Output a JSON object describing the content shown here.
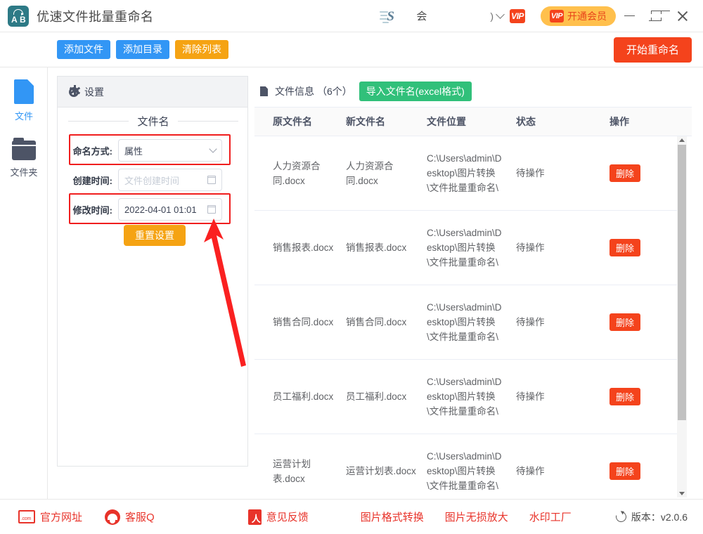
{
  "titlebar": {
    "app_name": "优速文件批量重命名",
    "app_icon": "rename-app-icon",
    "account_name": "会",
    "account_paren": ")",
    "vip_square_label": "VIP",
    "vip_button_label": "开通会员",
    "vip_button_color": "#ffc04d",
    "vip_button_text_color": "#e8451a",
    "minimize_label": "minimize",
    "maximize_label": "maximize",
    "close_label": "close"
  },
  "toolbar": {
    "add_file": "添加文件",
    "add_dir": "添加目录",
    "clear_list": "清除列表",
    "start_rename": "开始重命名",
    "blue": "#3296f5",
    "orange": "#f5a313",
    "red": "#f4431c"
  },
  "rail": {
    "items": [
      {
        "label": "文件",
        "icon": "document-icon",
        "active": true
      },
      {
        "label": "文件夹",
        "icon": "folder-icon",
        "active": false
      }
    ]
  },
  "settings": {
    "header_title": "设置",
    "header_icon": "gear-icon",
    "section_title": "文件名",
    "reset_label": "重置设置",
    "rows": [
      {
        "label": "命名方式:",
        "value": "属性",
        "placeholder": "",
        "kind": "select",
        "highlighted": true
      },
      {
        "label": "创建时间:",
        "value": "",
        "placeholder": "文件创建时间",
        "kind": "date",
        "highlighted": false
      },
      {
        "label": "修改时间:",
        "value": "2022-04-01 01:01",
        "placeholder": "",
        "kind": "date",
        "highlighted": true
      }
    ],
    "highlight_color": "#f01e1e"
  },
  "filelist": {
    "title": "文件信息",
    "count": "（6个）",
    "import_label": "导入文件名(excel格式)",
    "import_color": "#31c07a",
    "columns": [
      "原文件名",
      "新文件名",
      "文件位置",
      "状态",
      "操作"
    ],
    "delete_label": "删除",
    "rows": [
      {
        "original": "人力资源合同.docx",
        "new": "人力资源合同.docx",
        "location": "C:\\Users\\admin\\Desktop\\图片转换\\文件批量重命名\\",
        "status": "待操作"
      },
      {
        "original": "销售报表.docx",
        "new": "销售报表.docx",
        "location": "C:\\Users\\admin\\Desktop\\图片转换\\文件批量重命名\\",
        "status": "待操作"
      },
      {
        "original": "销售合同.docx",
        "new": "销售合同.docx",
        "location": "C:\\Users\\admin\\Desktop\\图片转换\\文件批量重命名\\",
        "status": "待操作"
      },
      {
        "original": "员工福利.docx",
        "new": "员工福利.docx",
        "location": "C:\\Users\\admin\\Desktop\\图片转换\\文件批量重命名\\",
        "status": "待操作"
      },
      {
        "original": "运营计划表.docx",
        "new": "运营计划表.docx",
        "location": "C:\\Users\\admin\\Desktop\\图片转换\\文件批量重命名\\",
        "status": "待操作"
      }
    ]
  },
  "footer": {
    "website": "官方网址",
    "customer_service": "客服Q",
    "feedback": "意见反馈",
    "convert": "图片格式转换",
    "enlarge": "图片无损放大",
    "watermark": "水印工厂",
    "version": "版本：v2.0.6",
    "link_color": "#e8332a"
  },
  "annotation": {
    "arrow_color": "#fa2121"
  }
}
